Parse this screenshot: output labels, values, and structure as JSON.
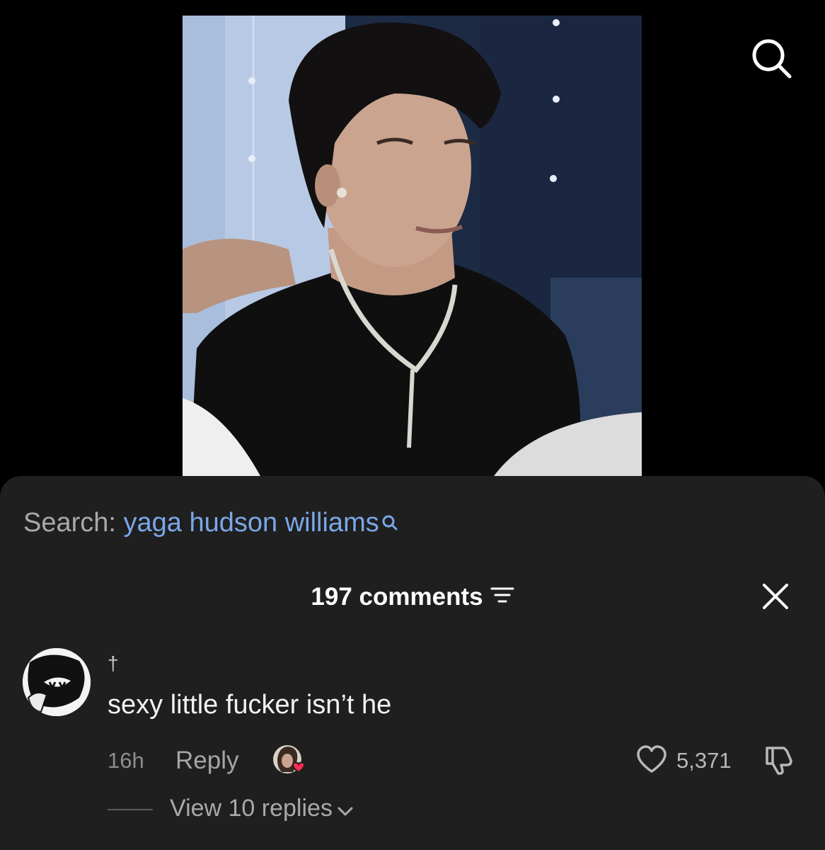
{
  "search_bar": {
    "label": "Search:",
    "query": "yaga hudson williams"
  },
  "comments": {
    "count_label": "197 comments"
  },
  "comment": {
    "username": "†",
    "text": "sexy little fucker isn’t he",
    "time": "16h",
    "reply_label": "Reply",
    "likes": "5,371",
    "view_replies_label": "View 10 replies"
  },
  "colors": {
    "sheet_bg": "#1f1f1f",
    "link_blue": "#7aa7e8",
    "creator_heart": "#fe2c55"
  },
  "icons": [
    "search-icon",
    "sort-icon",
    "close-icon",
    "heart-icon",
    "dislike-icon",
    "chevron-down-icon"
  ]
}
